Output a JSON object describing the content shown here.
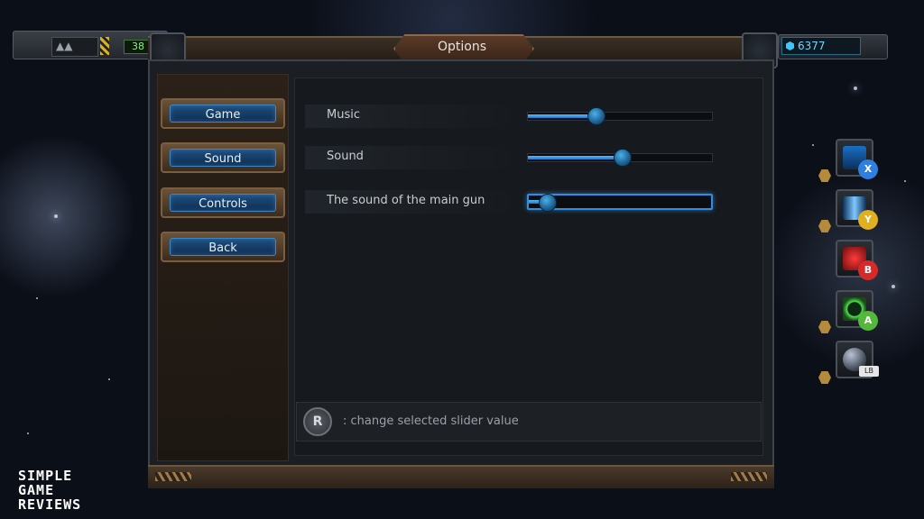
{
  "window": {
    "title": "Options"
  },
  "hud": {
    "ammo_count": "38",
    "credits": "6377"
  },
  "menu": {
    "items": [
      {
        "label": "Game"
      },
      {
        "label": "Sound"
      },
      {
        "label": "Controls"
      },
      {
        "label": "Back"
      }
    ]
  },
  "sound_settings": {
    "sliders": [
      {
        "label": "Music",
        "value_fraction": 0.37,
        "selected": false
      },
      {
        "label": "Sound",
        "value_fraction": 0.51,
        "selected": false
      },
      {
        "label": "The sound of the main gun",
        "value_fraction": 0.1,
        "selected": true
      }
    ]
  },
  "hint": {
    "button": "R",
    "text": ": change selected slider value"
  },
  "abilities": [
    {
      "icon": "lightning-icon",
      "button": "X",
      "color": "#2f7fe0"
    },
    {
      "icon": "laser-beam-icon",
      "button": "Y",
      "color": "#e0b020"
    },
    {
      "icon": "radiation-icon",
      "button": "B",
      "color": "#d62a2a"
    },
    {
      "icon": "shield-ring-icon",
      "button": "A",
      "color": "#54b83a"
    },
    {
      "icon": "orb-icon",
      "button": "LB",
      "color": "#e6e6e6"
    }
  ],
  "watermark": {
    "line1": "SIMPLE",
    "line2": "GAME",
    "line3": "REVIEWS"
  }
}
